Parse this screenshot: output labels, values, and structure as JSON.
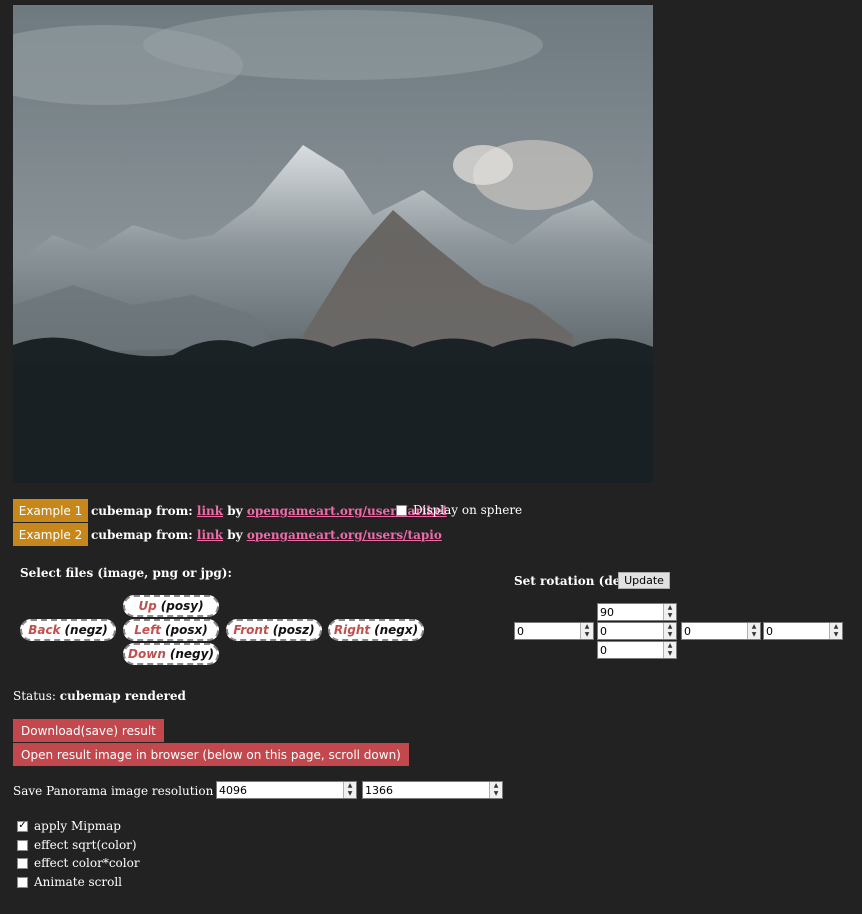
{
  "examples": [
    {
      "button": "Example 1",
      "prefix": "cubemap from:",
      "link": "link",
      "by": "by",
      "user_link": "opengameart.org/users/arikel"
    },
    {
      "button": "Example 2",
      "prefix": "cubemap from:",
      "link": "link",
      "by": "by",
      "user_link": "opengameart.org/users/tapio"
    }
  ],
  "display_on_sphere": {
    "label": "Display on sphere",
    "checked": false
  },
  "select_files_label": "Select files (image, png or jpg):",
  "faces": {
    "up": {
      "name": "Up",
      "code": "(posy)"
    },
    "back": {
      "name": "Back",
      "code": "(negz)"
    },
    "left": {
      "name": "Left",
      "code": "(posx)"
    },
    "front": {
      "name": "Front",
      "code": "(posz)"
    },
    "right": {
      "name": "Right",
      "code": "(negx)"
    },
    "down": {
      "name": "Down",
      "code": "(negy)"
    }
  },
  "rotation": {
    "label": "Set rotation (deg):",
    "update_label": "Update",
    "top": "90",
    "left": "0",
    "center": "0",
    "right1": "0",
    "right2": "0",
    "bottom": "0"
  },
  "status": {
    "label": "Status:",
    "value": "cubemap rendered"
  },
  "actions": {
    "download": "Download(save) result",
    "open": "Open result image in browser (below on this page, scroll down)"
  },
  "resolution": {
    "label": "Save Panorama image resolution (x,y):",
    "x": "4096",
    "y": "1366"
  },
  "options": [
    {
      "label": "apply Mipmap",
      "checked": true
    },
    {
      "label": "effect sqrt(color)",
      "checked": false
    },
    {
      "label": "effect color*color",
      "checked": false
    },
    {
      "label": "Animate scroll",
      "checked": false
    }
  ],
  "colors": {
    "example_button": "#c8871a",
    "action_button": "#c2484e",
    "link": "#f06aa7",
    "face_name": "#c0504d"
  }
}
